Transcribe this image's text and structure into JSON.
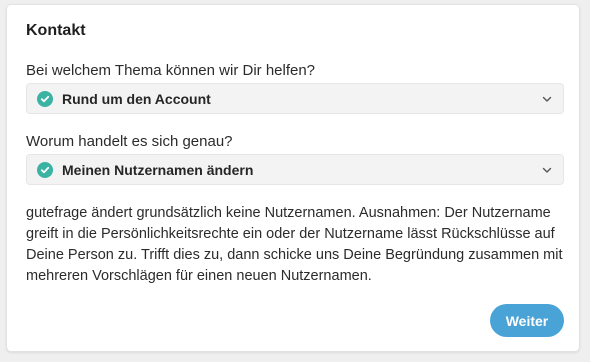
{
  "contact": {
    "title": "Kontakt",
    "topic_question": "Bei welchem Thema können wir Dir helfen?",
    "topic_selected": "Rund um den Account",
    "detail_question": "Worum handelt es sich genau?",
    "detail_selected": "Meinen Nutzernamen ändern",
    "info_text": "gutefrage ändert grundsätzlich keine Nutzernamen. Ausnahmen: Der Nutzername greift in die Persönlichkeitsrechte ein oder der Nutzername lässt Rückschlüsse auf Deine Person zu. Trifft dies zu, dann schicke uns Deine Begründung zusammen mit mehreren Vorschlägen für einen neuen Nutzernamen.",
    "continue_label": "Weiter"
  },
  "icons": {
    "selected": "check-circle-icon",
    "dropdown": "chevron-down-icon"
  },
  "colors": {
    "check": "#3bb3a3",
    "button": "#4aa3d6"
  }
}
